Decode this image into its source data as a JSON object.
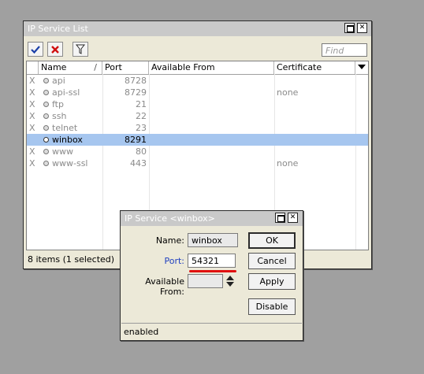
{
  "list_window": {
    "title": "IP Service List",
    "find_placeholder": "Find",
    "columns": [
      "Name",
      "Port",
      "Available From",
      "Certificate"
    ],
    "rows": [
      {
        "flag": "X",
        "name": "api",
        "port": "8728",
        "available_from": "",
        "certificate": ""
      },
      {
        "flag": "X",
        "name": "api-ssl",
        "port": "8729",
        "available_from": "",
        "certificate": "none"
      },
      {
        "flag": "X",
        "name": "ftp",
        "port": "21",
        "available_from": "",
        "certificate": ""
      },
      {
        "flag": "X",
        "name": "ssh",
        "port": "22",
        "available_from": "",
        "certificate": ""
      },
      {
        "flag": "X",
        "name": "telnet",
        "port": "23",
        "available_from": "",
        "certificate": ""
      },
      {
        "flag": "",
        "name": "winbox",
        "port": "8291",
        "available_from": "",
        "certificate": ""
      },
      {
        "flag": "X",
        "name": "www",
        "port": "80",
        "available_from": "",
        "certificate": ""
      },
      {
        "flag": "X",
        "name": "www-ssl",
        "port": "443",
        "available_from": "",
        "certificate": "none"
      }
    ],
    "status": "8 items (1 selected)"
  },
  "dialog": {
    "title": "IP Service <winbox>",
    "name_label": "Name:",
    "name_value": "winbox",
    "port_label": "Port:",
    "port_value": "54321",
    "available_from_label": "Available From:",
    "available_from_value": "",
    "buttons": {
      "ok": "OK",
      "cancel": "Cancel",
      "apply": "Apply",
      "disable": "Disable"
    },
    "status": "enabled"
  },
  "colors": {
    "selected_row": "#a6c6ef",
    "port_label": "#1f3fbf",
    "underline": "#e01010",
    "apply_check": "#1a3fa8",
    "remove_x": "#d01010"
  }
}
